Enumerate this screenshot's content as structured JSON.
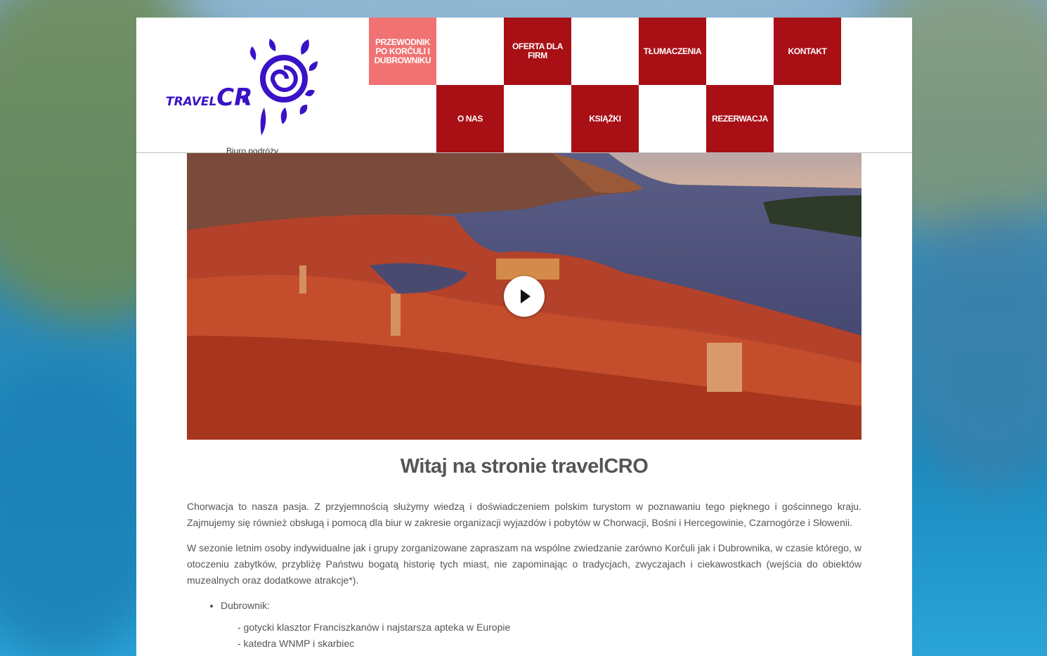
{
  "brand": {
    "logo_part1": "TRAVEL",
    "logo_part2": "CR",
    "subtitle": "Biuro podróży",
    "color": "#3a12c8"
  },
  "nav": {
    "accent_color": "#a81016",
    "active_color": "#f07272",
    "items": [
      {
        "label": "PRZEWODNIK PO KORČULI I DUBROWNIKU",
        "active": true
      },
      {
        "label": "O NAS"
      },
      {
        "label": "OFERTA DLA FIRM"
      },
      {
        "label": "KSIĄŻKI"
      },
      {
        "label": "TŁUMACZENIA"
      },
      {
        "label": "REZERWACJA"
      },
      {
        "label": "KONTAKT"
      }
    ]
  },
  "video": {
    "play_icon": "play-icon"
  },
  "main": {
    "heading": "Witaj na stronie travelCRO",
    "paragraph1": "Chorwacja to nasza pasja. Z przyjemnością służymy wiedzą i doświadczeniem polskim turystom w poznawaniu tego pięknego i gościnnego kraju. Zajmujemy się również obsługą i pomocą dla biur w zakresie organizacji wyjazdów i pobytów w Chorwacji, Bośni i Hercegowinie, Czarnogórze i Słowenii.",
    "paragraph2": "W sezonie letnim osoby indywidualne jak i grupy zorganizowane zapraszam na wspólne zwiedzanie zarówno Korčuli jak i Dubrownika, w czasie którego, w otoczeniu zabytków, przybliżę Państwu bogatą historię tych miast, nie zapominając o tradycjach, zwyczajach i ciekawostkach (wejścia do obiektów muzealnych oraz dodatkowe atrakcje*).",
    "list_item": "Dubrownik:",
    "sub_items": [
      "- gotycki klasztor Franciszkanów i najstarsza apteka w Europie",
      "- katedra WNMP i skarbiec"
    ]
  }
}
